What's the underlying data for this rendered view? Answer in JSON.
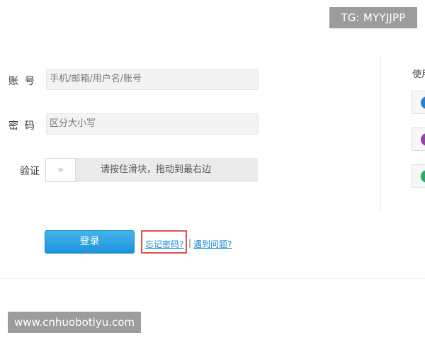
{
  "badge": {
    "text": "TG: MYYJJPP"
  },
  "form": {
    "account": {
      "label": "账  号",
      "placeholder": "手机/邮箱/用户名/账号"
    },
    "password": {
      "label": "密  码",
      "placeholder": "区分大小写"
    },
    "verify": {
      "label": "验证",
      "handle_glyph": "»",
      "instruction": "请按住滑块，拖动到最右边"
    },
    "login_label": "登录",
    "forgot_label": "忘记密码?",
    "separator": "|",
    "problem_label": "遇到问题?"
  },
  "side": {
    "title": "使用",
    "buttons": [
      {
        "icon": "app-login-icon",
        "color": "#2a7fd4"
      },
      {
        "icon": "app-login-icon",
        "color": "#8e44ad"
      },
      {
        "icon": "app-login-icon",
        "color": "#27ae60"
      }
    ]
  },
  "watermark": {
    "text": "www.cnhuobotiyu.com"
  }
}
